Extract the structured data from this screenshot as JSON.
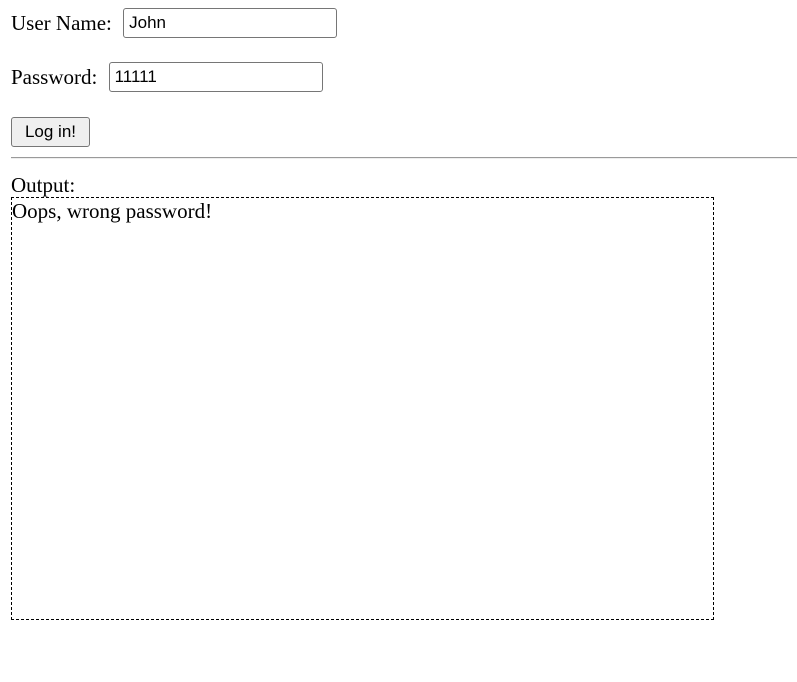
{
  "login_form": {
    "username_label": "User Name: ",
    "username_value": "John",
    "password_label": "Password: ",
    "password_value": "11111",
    "submit_label": "Log in!"
  },
  "output": {
    "label": "Output:",
    "message": "Oops, wrong password!"
  }
}
